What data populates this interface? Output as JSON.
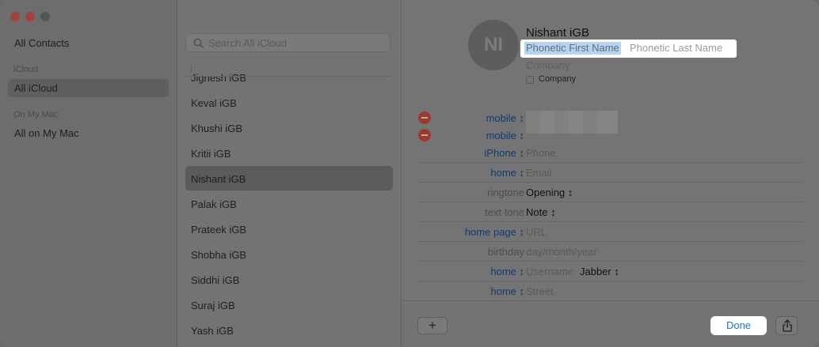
{
  "window": {
    "traffic_lights": [
      "close",
      "minimize",
      "zoom"
    ]
  },
  "sidebar": {
    "all_contacts": "All Contacts",
    "icloud_heading": "iCloud",
    "all_icloud": "All iCloud",
    "on_my_mac_heading": "On My Mac",
    "all_on_my_mac": "All on My Mac"
  },
  "list": {
    "search_placeholder": "Search All iCloud",
    "contacts": [
      "Jignesh iGB",
      "Keval iGB",
      "Khushi iGB",
      "Kritii iGB",
      "Nishant iGB",
      "Palak iGB",
      "Prateek iGB",
      "Shobha iGB",
      "Siddhi iGB",
      "Suraj iGB",
      "Yash iGB"
    ],
    "selected": "Nishant iGB"
  },
  "card": {
    "initials": "NI",
    "name": "Nishant  iGB",
    "phonetic_first": "Phonetic First Name",
    "phonetic_last": "Phonetic Last Name",
    "company_placeholder": "Company",
    "company_checkbox_label": "Company",
    "fields": [
      {
        "label": "mobile ↕",
        "value": ""
      },
      {
        "label": "mobile ↕",
        "value": ""
      },
      {
        "label": "iPhone ↕",
        "value": "Phone"
      },
      {
        "label": "home ↕",
        "value": "Email"
      },
      {
        "label": "ringtone",
        "value": "Opening ↕"
      },
      {
        "label": "text tone",
        "value": "Note ↕"
      },
      {
        "label": "home page ↕",
        "value": "URL"
      },
      {
        "label": "birthday",
        "value": "day/month/year"
      },
      {
        "label": "home ↕",
        "value": "Username",
        "extra": "Jabber ↕"
      },
      {
        "label": "home ↕",
        "value": "Street"
      }
    ]
  },
  "footer": {
    "add_label": "+",
    "done_label": "Done"
  },
  "colors": {
    "accent": "#1a73d6",
    "remove": "#9b3a32",
    "selection": "#b3d4f7"
  }
}
